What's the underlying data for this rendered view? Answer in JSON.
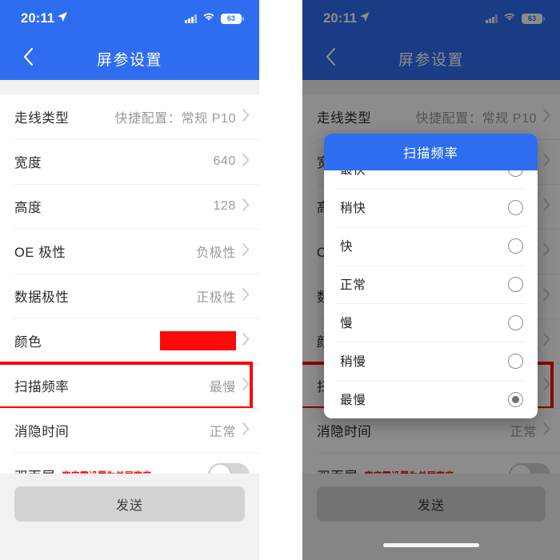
{
  "status_bar": {
    "time": "20:11",
    "battery_level": "63",
    "icons": [
      "location-arrow-icon",
      "signal-bars-icon",
      "wifi-icon",
      "battery-icon"
    ]
  },
  "nav": {
    "back_icon": "chevron-left-icon",
    "title": "屏参设置"
  },
  "settings_rows": [
    {
      "label": "走线类型",
      "value": "快捷配置：常规 P10",
      "type": "value",
      "highlight": false
    },
    {
      "label": "宽度",
      "value": "640",
      "type": "value",
      "highlight": false
    },
    {
      "label": "高度",
      "value": "128",
      "type": "value",
      "highlight": false
    },
    {
      "label": "OE 极性",
      "value": "负极性",
      "type": "value",
      "highlight": false
    },
    {
      "label": "数据极性",
      "value": "正极性",
      "type": "value",
      "highlight": false
    },
    {
      "label": "颜色",
      "value": "",
      "type": "color",
      "highlight": false,
      "swatch_color": "#fb0a0a"
    },
    {
      "label": "扫描频率",
      "value": "最慢",
      "type": "value",
      "highlight": true
    },
    {
      "label": "消隐时间",
      "value": "正常",
      "type": "value",
      "highlight": false
    },
    {
      "label": "双面屏",
      "value": "",
      "type": "toggle",
      "highlight": false,
      "note": "宽度需设置为单屏宽度",
      "toggle_on": false
    }
  ],
  "footer": {
    "send_label": "发送"
  },
  "modal": {
    "title": "扫描频率",
    "options": [
      {
        "label": "最快",
        "selected": false,
        "clipped": true
      },
      {
        "label": "稍快",
        "selected": false,
        "clipped": false
      },
      {
        "label": "快",
        "selected": false,
        "clipped": false
      },
      {
        "label": "正常",
        "selected": false,
        "clipped": false
      },
      {
        "label": "慢",
        "selected": false,
        "clipped": false
      },
      {
        "label": "稍慢",
        "selected": false,
        "clipped": false
      },
      {
        "label": "最慢",
        "selected": true,
        "clipped": false
      }
    ]
  },
  "colors": {
    "brand_blue": "#2f6df0",
    "highlight_red": "#ff0000",
    "swatch_red": "#fb0a0a",
    "note_red": "#ff0a0a",
    "page_bg": "#f2f2f2"
  }
}
